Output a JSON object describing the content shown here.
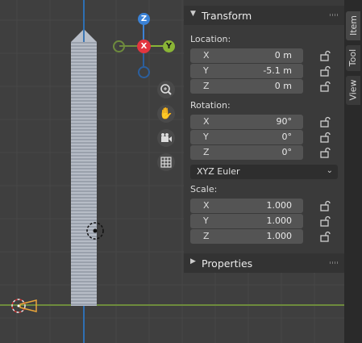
{
  "gizmo": {
    "z": "Z",
    "x": "X",
    "y": "Y"
  },
  "nav_icons": [
    "zoom-icon",
    "hand-pan-icon",
    "camera-icon",
    "grid-view-icon"
  ],
  "panel": {
    "transform_title": "Transform",
    "location_label": "Location:",
    "location": [
      {
        "axis": "X",
        "value": "0 m"
      },
      {
        "axis": "Y",
        "value": "-5.1 m"
      },
      {
        "axis": "Z",
        "value": "0 m"
      }
    ],
    "rotation_label": "Rotation:",
    "rotation": [
      {
        "axis": "X",
        "value": "90°"
      },
      {
        "axis": "Y",
        "value": "0°"
      },
      {
        "axis": "Z",
        "value": "0°"
      }
    ],
    "rotation_mode": "XYZ Euler",
    "scale_label": "Scale:",
    "scale": [
      {
        "axis": "X",
        "value": "1.000"
      },
      {
        "axis": "Y",
        "value": "1.000"
      },
      {
        "axis": "Z",
        "value": "1.000"
      }
    ],
    "properties_title": "Properties"
  },
  "tabs": [
    "Item",
    "Tool",
    "View"
  ],
  "colors": {
    "x_axis": "#e2353f",
    "y_axis": "#8ab536",
    "z_axis": "#3b82d6",
    "active_tab": "#3a3a3a"
  }
}
